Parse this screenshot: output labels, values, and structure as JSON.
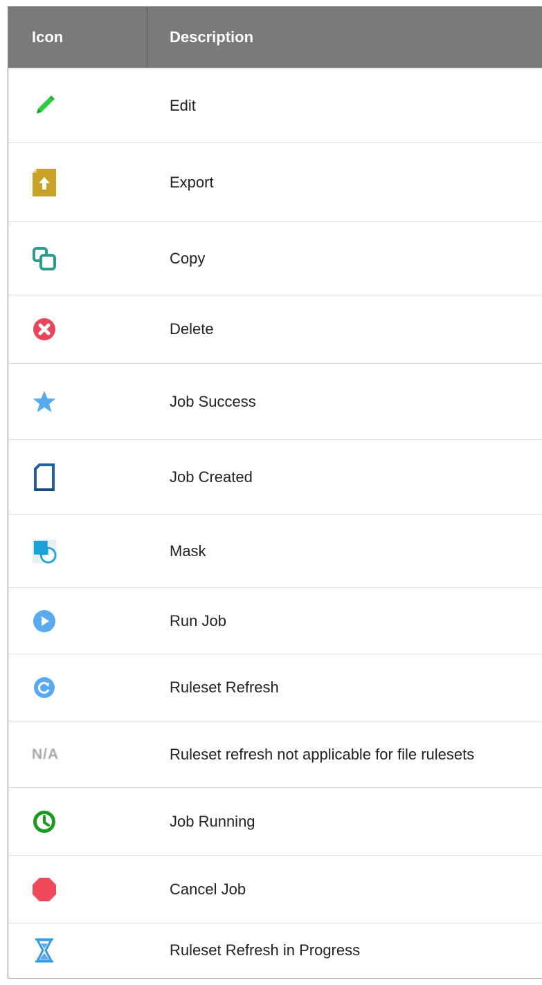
{
  "table": {
    "headers": {
      "icon": "Icon",
      "description": "Description"
    },
    "rows": [
      {
        "icon": "pencil-edit-icon",
        "description": "Edit"
      },
      {
        "icon": "export-file-icon",
        "description": "Export"
      },
      {
        "icon": "copy-icon",
        "description": "Copy"
      },
      {
        "icon": "delete-icon",
        "description": "Delete"
      },
      {
        "icon": "star-icon",
        "description": "Job Success"
      },
      {
        "icon": "document-icon",
        "description": "Job Created"
      },
      {
        "icon": "mask-icon",
        "description": "Mask"
      },
      {
        "icon": "play-icon",
        "description": "Run Job"
      },
      {
        "icon": "refresh-icon",
        "description": "Ruleset Refresh"
      },
      {
        "icon": "na-text",
        "icon_text": "N/A",
        "description": "Ruleset refresh not applicable for file rulesets"
      },
      {
        "icon": "clock-icon",
        "description": "Job Running"
      },
      {
        "icon": "stop-icon",
        "description": "Cancel Job"
      },
      {
        "icon": "hourglass-icon",
        "description": "Ruleset Refresh in Progress"
      }
    ]
  },
  "colors": {
    "header_bg": "#7a7a7a",
    "edit_green": "#2ecc40",
    "export_gold": "#c9a227",
    "copy_teal": "#2a9d8f",
    "delete_red": "#e8475b",
    "star_blue": "#5aaaf0",
    "doc_blue": "#1f5fa8",
    "mask_cyan": "#1aa3d9",
    "play_blue": "#5aaaf0",
    "clock_green": "#1e9a1e",
    "stop_red": "#f04a5a",
    "hourglass_blue": "#3a9ae0"
  }
}
